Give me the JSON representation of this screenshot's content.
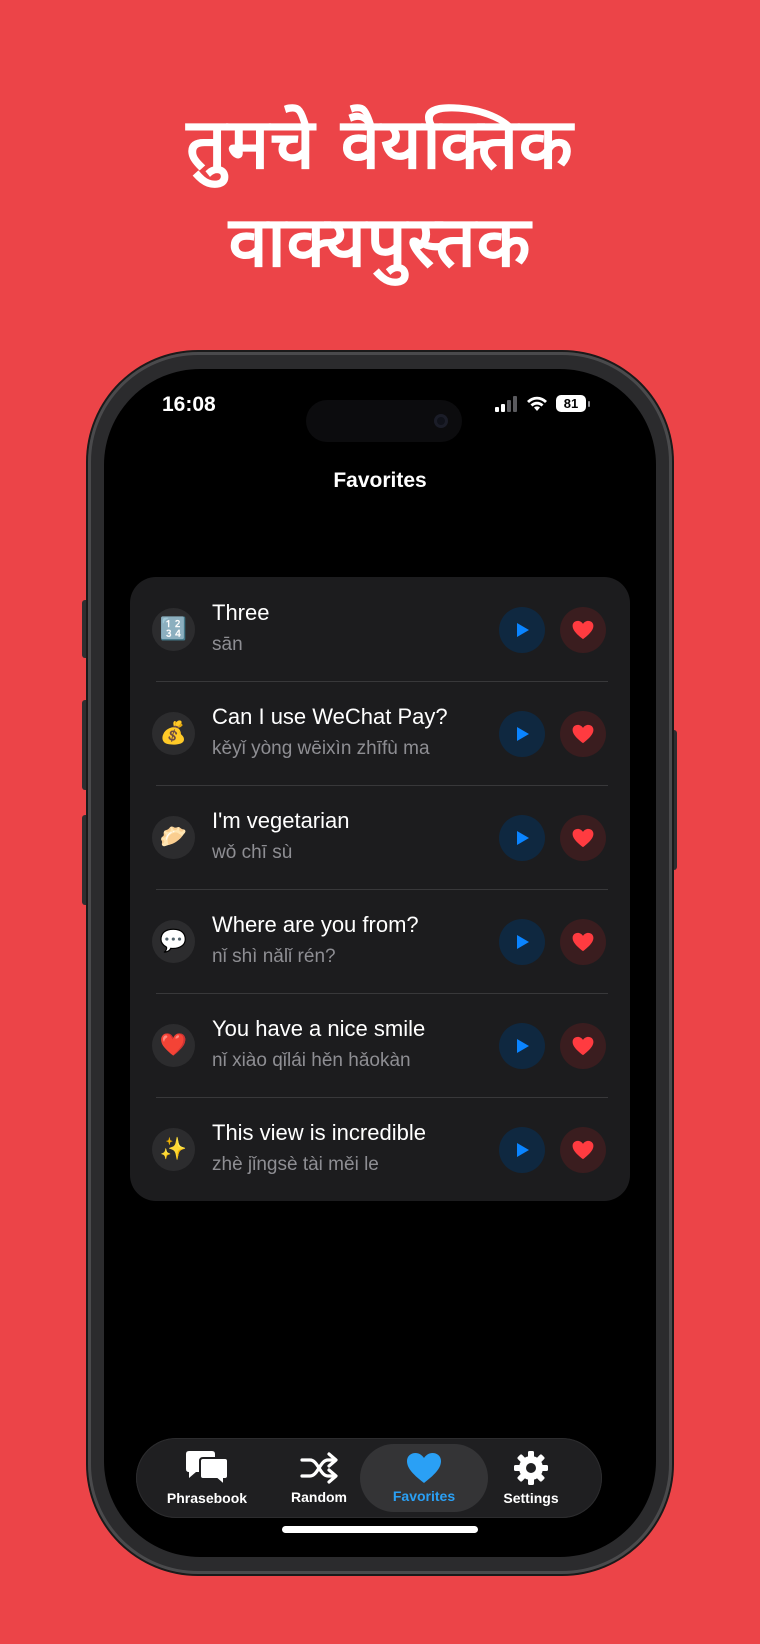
{
  "colors": {
    "background": "#ec4448",
    "accent": "#2aa0f5",
    "heart": "#ff3b40",
    "play": "#0a84ff"
  },
  "headline": {
    "line1": "तुमचे वैयक्तिक",
    "line2": "वाक्यपुस्तक"
  },
  "status_bar": {
    "time": "16:08",
    "battery": "81",
    "icons": [
      "signal-icon",
      "wifi-icon",
      "battery-icon"
    ]
  },
  "nav": {
    "title": "Favorites"
  },
  "favorites": [
    {
      "emoji": "🔢",
      "icon": "numbers-icon",
      "phrase": "Three",
      "pinyin": "sān"
    },
    {
      "emoji": "💰",
      "icon": "money-bag-icon",
      "phrase": "Can I use WeChat Pay?",
      "pinyin": "kěyǐ yòng wēixìn zhīfù ma"
    },
    {
      "emoji": "🥟",
      "icon": "dumpling-icon",
      "phrase": "I'm vegetarian",
      "pinyin": "wǒ chī sù"
    },
    {
      "emoji": "💬",
      "icon": "speech-bubble-icon",
      "phrase": "Where are you from?",
      "pinyin": "nǐ shì nǎlǐ rén?"
    },
    {
      "emoji": "❤️",
      "icon": "red-heart-icon",
      "phrase": "You have a nice smile",
      "pinyin": "nǐ xiào qǐlái hěn hǎokàn"
    },
    {
      "emoji": "✨",
      "icon": "sparkles-icon",
      "phrase": "This view is incredible",
      "pinyin": "zhè jǐngsè tài měi le"
    }
  ],
  "tabbar": {
    "tabs": [
      {
        "label": "Phrasebook",
        "icon": "chat-bubbles-icon"
      },
      {
        "label": "Random",
        "icon": "shuffle-icon"
      },
      {
        "label": "Favorites",
        "icon": "heart-icon",
        "selected": true
      },
      {
        "label": "Settings",
        "icon": "gear-icon"
      }
    ]
  }
}
